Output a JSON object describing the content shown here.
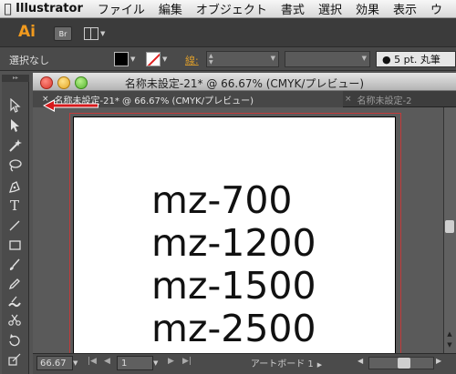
{
  "menubar": {
    "apple": "",
    "app_name": "Illustrator",
    "items": [
      "ファイル",
      "編集",
      "オブジェクト",
      "書式",
      "選択",
      "効果",
      "表示",
      "ウ"
    ]
  },
  "appbar": {
    "logo": "Ai",
    "bridge_label": "Br"
  },
  "controlbar": {
    "selection_status": "選択なし",
    "stroke_label": "線",
    "brush_definition": "● 5 pt. 丸筆"
  },
  "document": {
    "window_title": "名称未設定-21* @ 66.67% (CMYK/プレビュー)",
    "tabs": [
      {
        "label": "名称未設定-21* @ 66.67% (CMYK/プレビュー)",
        "active": true
      },
      {
        "label": "名称未設定-2",
        "active": false
      }
    ],
    "tab_close_glyph": "×"
  },
  "artboard_text": {
    "lines": [
      "mz-700",
      "mz-1200",
      "mz-1500",
      "mz-2500"
    ]
  },
  "statusbar": {
    "zoom": "66.67",
    "artboard_number": "1",
    "artboard_name": "アートボード 1"
  },
  "colors": {
    "accent_orange": "#f19a1e",
    "arrow_red": "#d7191c",
    "artboard_border": "#c23a3a"
  }
}
